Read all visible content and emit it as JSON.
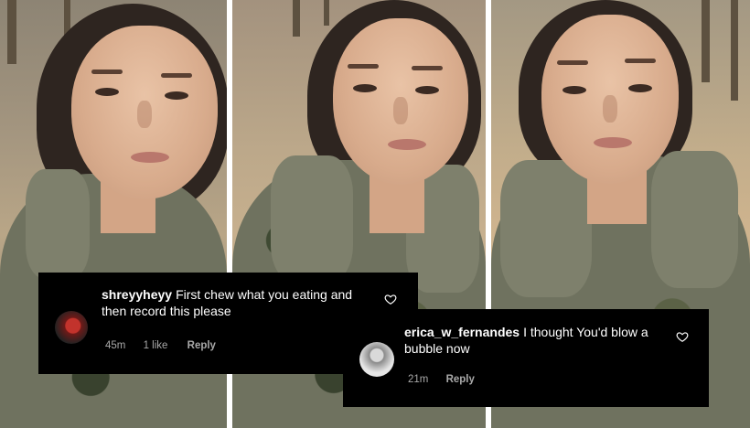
{
  "comments": [
    {
      "username": "shreyyheyy",
      "text": "First chew what you eating and then record this please",
      "time": "45m",
      "likes": "1 like",
      "reply_label": "Reply",
      "like_icon": "heart-outline-icon"
    },
    {
      "username": "erica_w_fernandes",
      "text": "I thought You'd blow a bubble now",
      "time": "21m",
      "reply_label": "Reply",
      "like_icon": "heart-outline-icon"
    }
  ],
  "colors": {
    "comment_background": "#000000",
    "comment_text": "#ffffff",
    "meta_text": "#a9a9a9",
    "separator": "#ffffff"
  }
}
